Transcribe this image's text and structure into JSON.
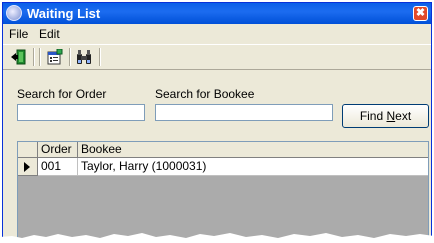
{
  "window": {
    "title": "Waiting List",
    "close_glyph": "✖"
  },
  "menu": [
    {
      "label": "File"
    },
    {
      "label": "Edit"
    }
  ],
  "toolbar": {
    "icons": [
      "exit-door-icon",
      "properties-icon",
      "binoculars-find-icon"
    ]
  },
  "search": {
    "order_label": "Search for Order",
    "order_value": "",
    "bookee_label": "Search for Bookee",
    "bookee_value": "",
    "find_next_prefix": "Find ",
    "find_next_underlined": "N",
    "find_next_suffix": "ext"
  },
  "grid": {
    "columns": [
      "Order",
      "Bookee"
    ],
    "rows": [
      {
        "order": "001",
        "bookee": "Taylor, Harry (1000031)",
        "current": true
      }
    ]
  },
  "colors": {
    "titlebar": "#0a5fe8",
    "window_bg": "#ece9d8",
    "grid_empty": "#ababab"
  }
}
